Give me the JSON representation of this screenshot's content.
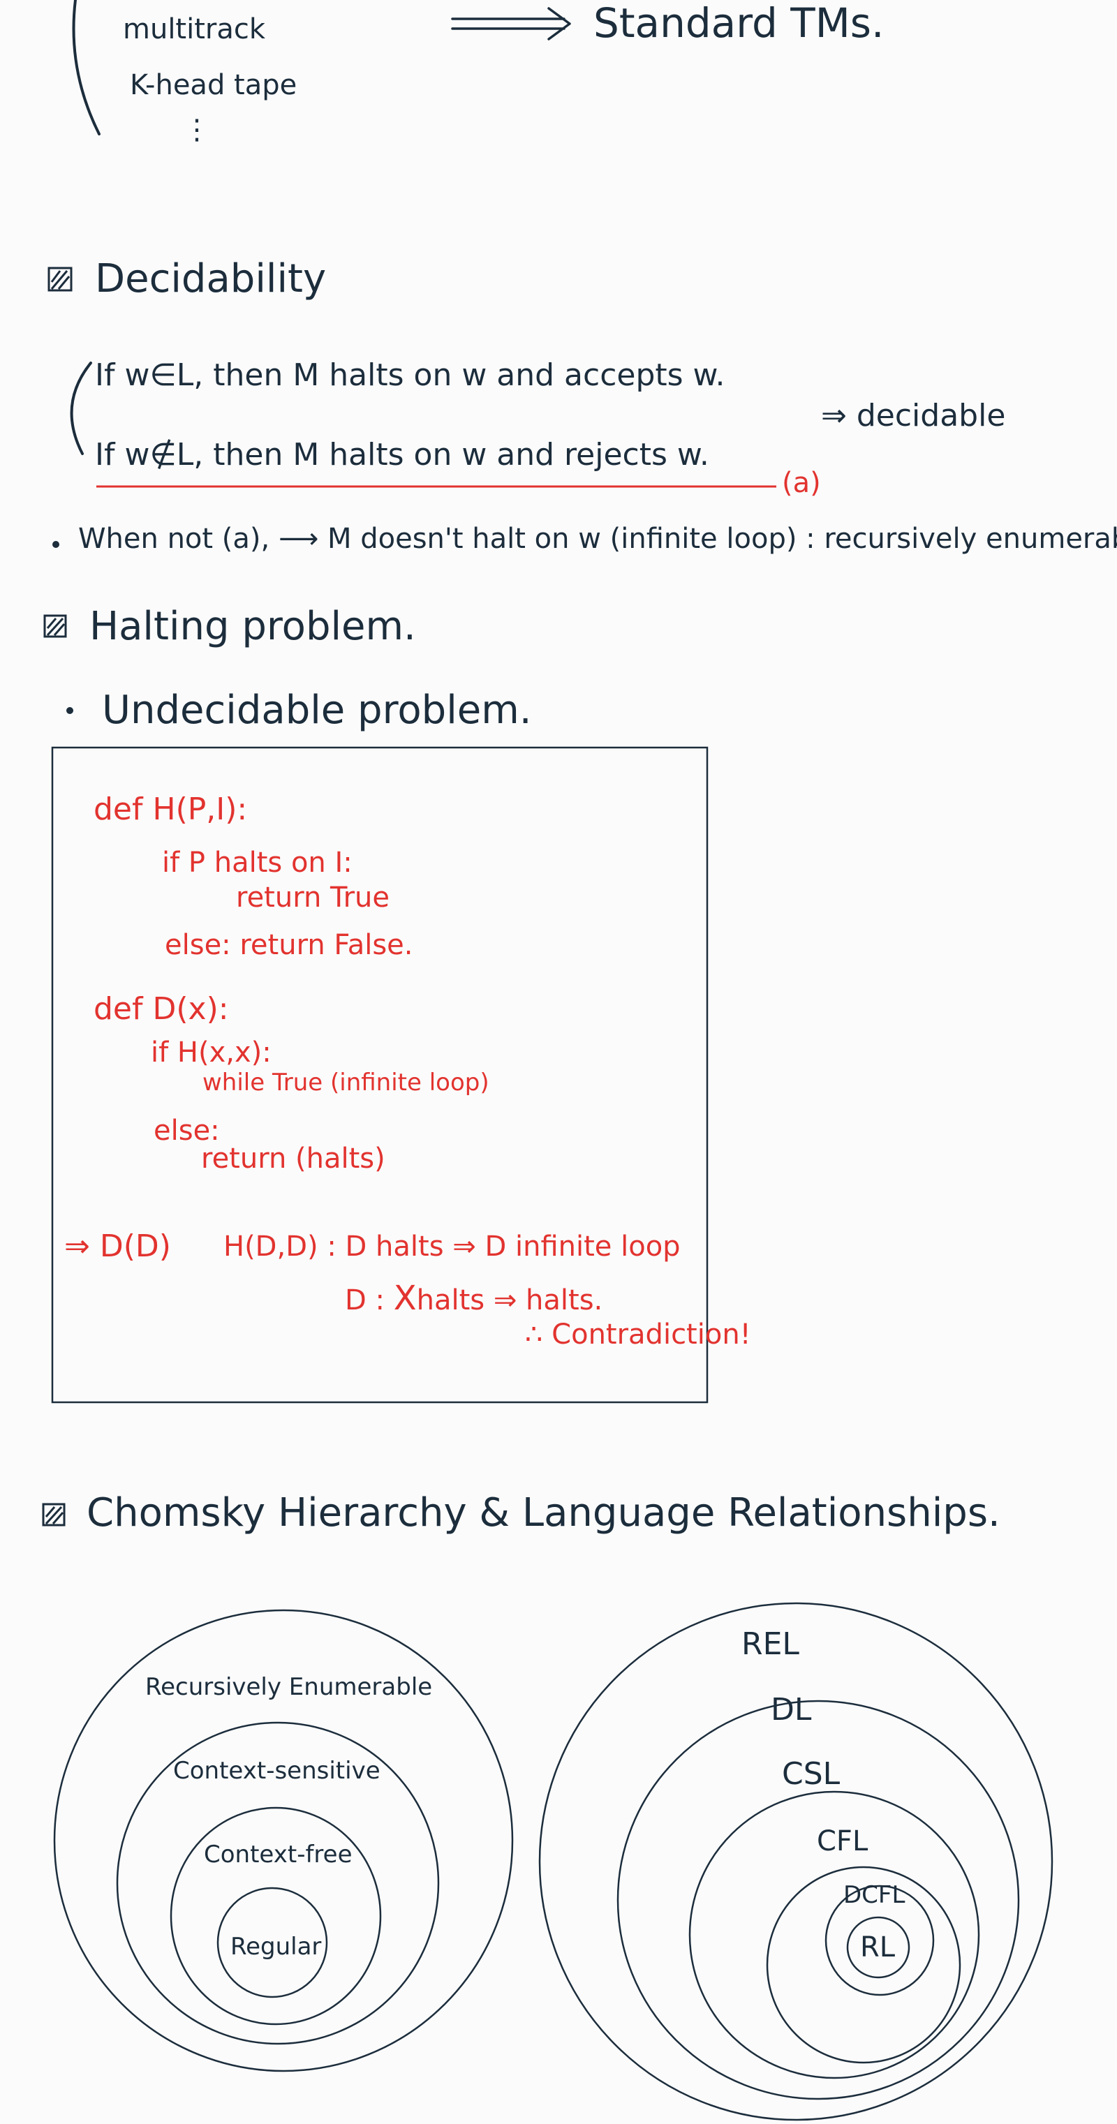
{
  "top": {
    "variants": [
      "multitrack",
      "K-head tape",
      "⋮"
    ],
    "arrow": "⟹",
    "result": "Standard TMs."
  },
  "decidability": {
    "title": "Decidability",
    "line1": "If w∈L, then M halts on w and accepts w.",
    "line2": "If w∉L, then M halts on w and rejects w.",
    "label_a": "(a)",
    "conclusion": "⇒ decidable",
    "bullet": "When not (a), ⟶ M doesn't halt on w (infinite loop) : recursively enumerable"
  },
  "halting": {
    "title": "Halting problem.",
    "bullet": "Undecidable problem.",
    "code": [
      "def H(P,I):",
      "if P halts on I:",
      "return True",
      "else: return False.",
      "def D(x):",
      "if H(x,x):",
      "while True (infinite loop)",
      "else:",
      "return (halts)"
    ],
    "proof": {
      "lead": "⇒ D(D)",
      "line1": "H(D,D) : D halts ⇒ D infinite loop",
      "line2_pre": "D : ",
      "line2_struck": "X",
      "line2_post": "halts ⇒ halts.",
      "line3": "∴ Contradiction!"
    }
  },
  "chomsky": {
    "title": "Chomsky Hierarchy & Language Relationships.",
    "left_labels": [
      "Recursively Enumerable",
      "Context-sensitive",
      "Context-free",
      "Regular"
    ],
    "right_labels": [
      "REL",
      "DL",
      "CSL",
      "CFL",
      "DCFL",
      "RL"
    ]
  },
  "colors": {
    "ink": "#1c2d3c",
    "red": "#e2332f",
    "paper": "#fbfbfb"
  }
}
